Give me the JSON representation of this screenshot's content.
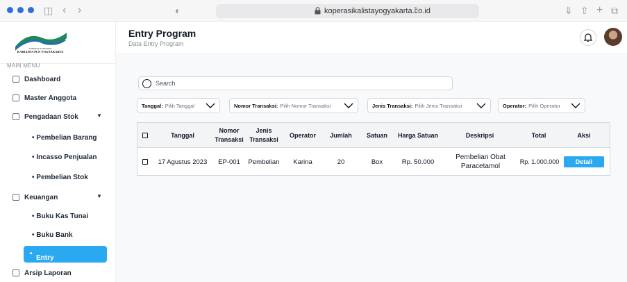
{
  "browser": {
    "url": "koperasikalistayogyakarta.co.id"
  },
  "sidebar": {
    "logo_text_top": "KOPERASI KARYAWAN",
    "logo_text": "KARLISNA PLN YOGYAKARTA",
    "menu_heading": "MAIN MENU",
    "items": [
      {
        "label": "Dashboard"
      },
      {
        "label": "Master Anggota"
      },
      {
        "label": "Pengadaan Stok"
      },
      {
        "label": "Keuangan"
      },
      {
        "label": "Arsip Laporan"
      }
    ],
    "pengadaan_sub": [
      "Pembelian Barang",
      "Incasso Penjualan",
      "Pembelian Stok"
    ],
    "keuangan_sub": [
      "Buku Kas Tunai",
      "Buku Bank",
      "Entry Program"
    ],
    "active_sub": "Entry Program"
  },
  "header": {
    "title": "Entry Program",
    "subtitle": "Data Entry Program"
  },
  "search": {
    "placeholder": "Search"
  },
  "filters": [
    {
      "label": "Tanggal:",
      "value": "Pilih Tanggal"
    },
    {
      "label": "Nomor Transaksi:",
      "value": "Pilih Nomor Transaksi"
    },
    {
      "label": "Jenis Transaksi:",
      "value": "Pilih Jenis Transaksi"
    },
    {
      "label": "Operator:",
      "value": "Pilih Operator"
    }
  ],
  "table": {
    "headers": [
      "Tanggal",
      "Nomor Transaksi",
      "Jenis Transaksi",
      "Operator",
      "Jumlah",
      "Satuan",
      "Harga Satuan",
      "Deskripsi",
      "Total",
      "Aksi"
    ],
    "rows": [
      {
        "tanggal": "17 Agustus 2023",
        "nomor": "EP-001",
        "jenis": "Pembelian",
        "operator": "Karina",
        "jumlah": "20",
        "satuan": "Box",
        "harga": "Rp. 50.000",
        "deskripsi": "Pembelian Obat Paracetamol",
        "total": "Rp. 1.000.000",
        "aksi": "Detail"
      }
    ]
  },
  "colors": {
    "accent": "#2aa8f0",
    "traffic_dots": "#2f6fd6"
  }
}
